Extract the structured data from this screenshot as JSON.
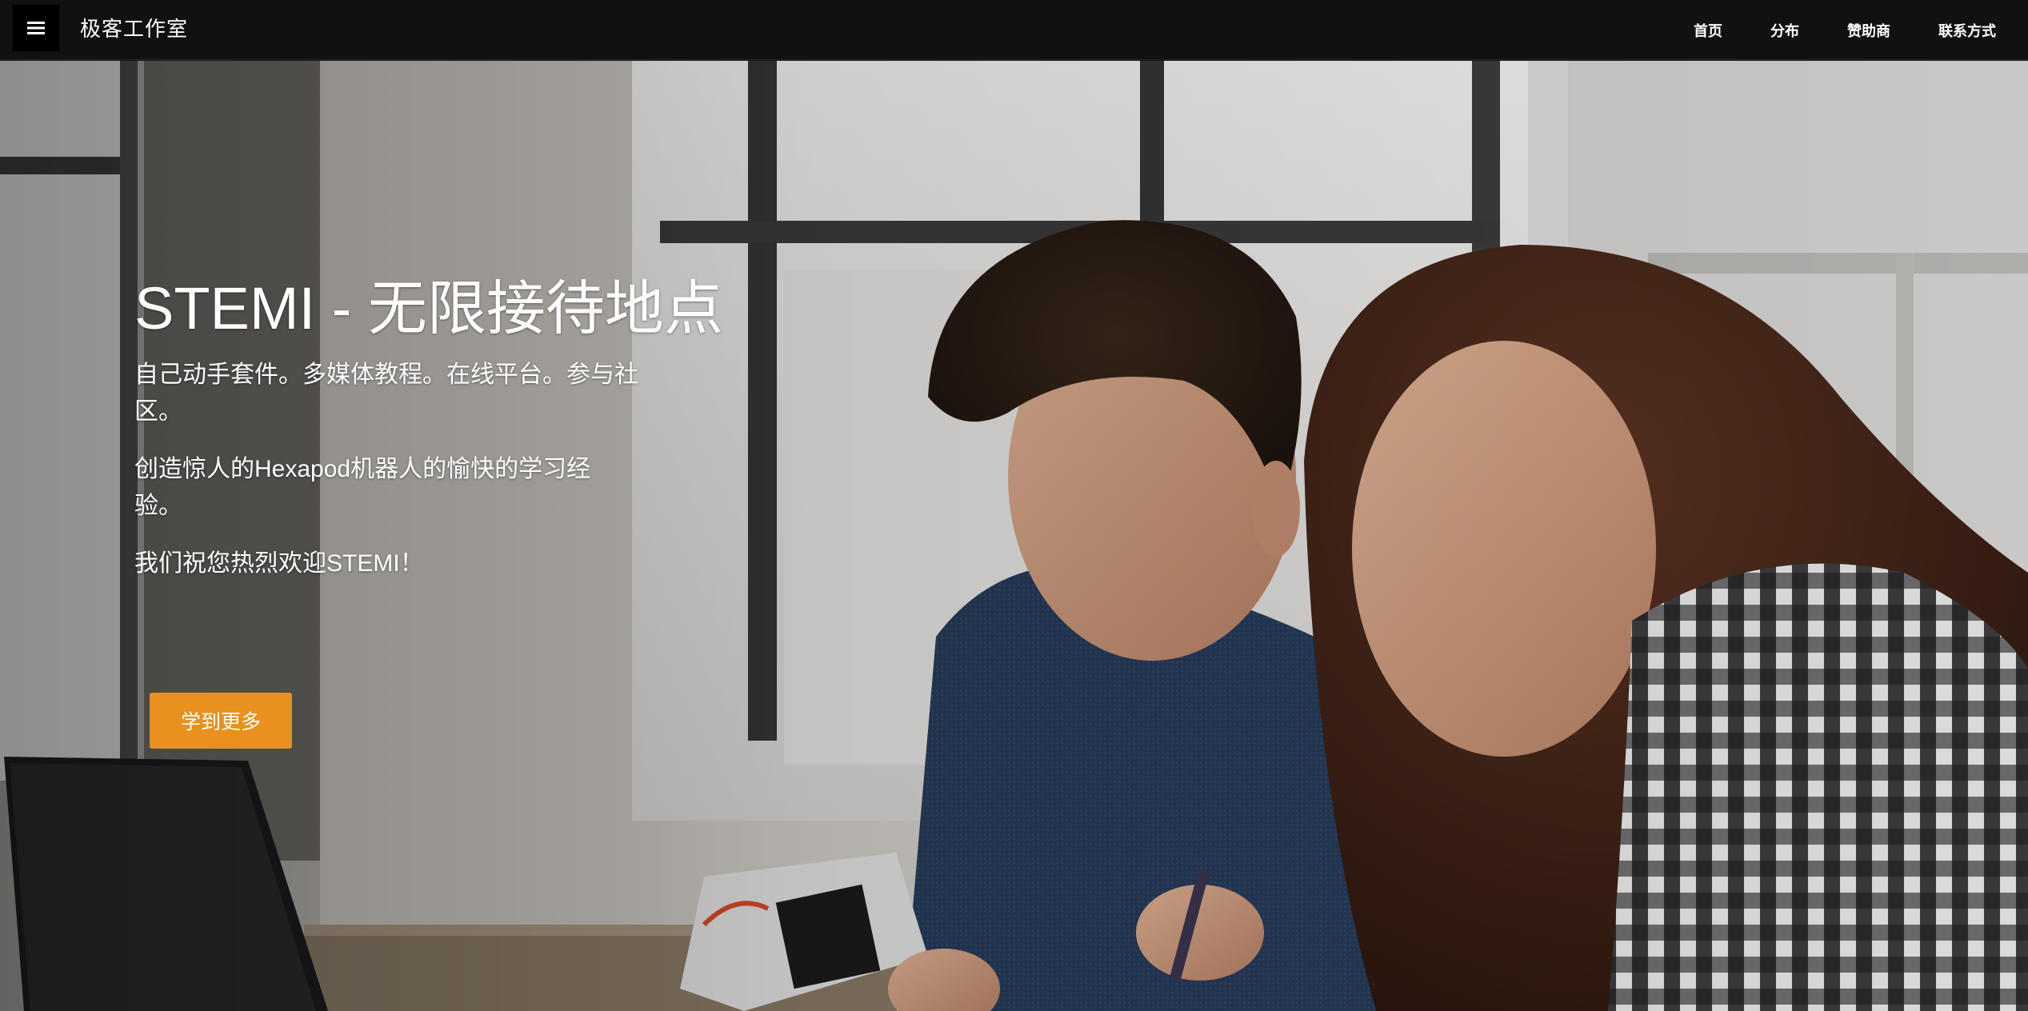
{
  "nav": {
    "menu_icon": "hamburger-menu-icon",
    "brand": "极客工作室",
    "links": [
      "首页",
      "分布",
      "赞助商",
      "联系方式"
    ]
  },
  "hero": {
    "title": "STEMI - 无限接待地点",
    "paragraphs": [
      "自己动手套件。多媒体教程。在线平台。参与社区。",
      "创造惊人的Hexapod机器人的愉快的学习经验。",
      "我们祝您热烈欢迎STEMI！"
    ],
    "cta_label": "学到更多",
    "image": "students-building-hexapod-robot-photo"
  },
  "colors": {
    "navbar": "#111111",
    "accent": "#e8911f",
    "text": "#ffffff"
  }
}
